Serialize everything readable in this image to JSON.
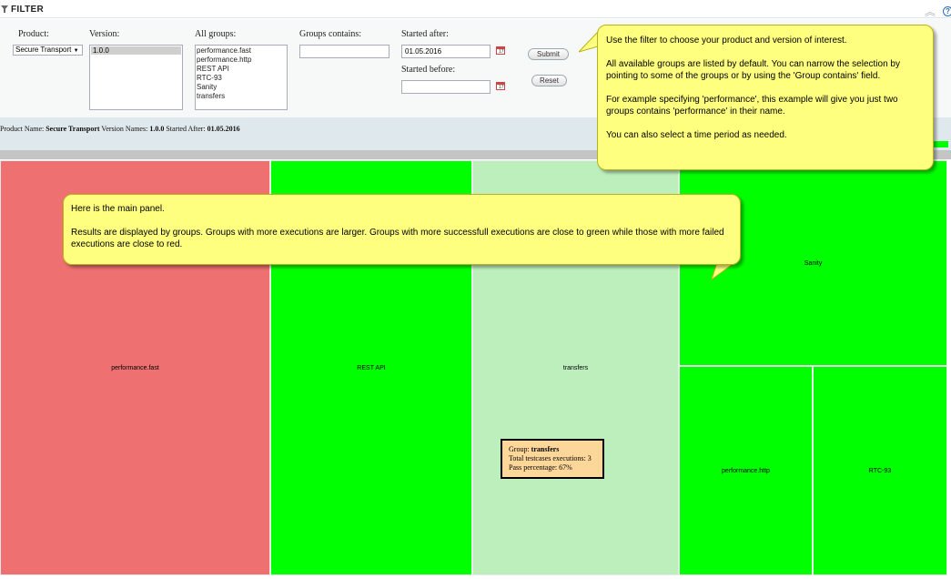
{
  "filter": {
    "title": "FILTER",
    "labels": {
      "product": "Product:",
      "version": "Version:",
      "all_groups": "All groups:",
      "groups_contains": "Groups contains:",
      "started_after": "Started after:",
      "started_before": "Started before:"
    },
    "product_value": "Secure Transport",
    "version_selected": "1.0.0",
    "groups": [
      "performance.fast",
      "performance.http",
      "REST API",
      "RTC-93",
      "Sanity",
      "transfers"
    ],
    "groups_contains_value": "",
    "started_after_value": "01.05.2016",
    "started_before_value": "",
    "submit_label": "Submit",
    "reset_label": "Reset"
  },
  "summary": {
    "product_label": "Product Name:",
    "product": "Secure Transport",
    "version_label": "Version Names:",
    "version": "1.0.0",
    "started_label": "Started After:",
    "started": "01.05.2016"
  },
  "treemap": {
    "cells": [
      {
        "name": "performance.fast",
        "color": "#ee7070"
      },
      {
        "name": "REST API",
        "color": "#00ff00"
      },
      {
        "name": "transfers",
        "color": "#bdefbd"
      },
      {
        "name": "Sanity",
        "color": "#00ff00"
      },
      {
        "name": "performance.http",
        "color": "#00ff00"
      },
      {
        "name": "RTC-93",
        "color": "#00ff00"
      }
    ]
  },
  "tooltip": {
    "group_label": "Group:",
    "group": "transfers",
    "executions_label": "Total testcases executions:",
    "executions": "3",
    "pass_label": "Pass percentage:",
    "pass": "67%"
  },
  "callouts": {
    "filter": [
      "Use the filter to choose your product and version of interest.",
      "All available groups are listed by default. You can narrow the selection by pointing to some of the groups or by using the 'Group contains' field.",
      "For example specifying 'performance', this example will give you just two groups contains 'performance' in their name.",
      "You can also select a time period as needed."
    ],
    "main": [
      "Here is the main panel.",
      "Results are displayed by groups. Groups with more executions are larger. Groups with more successfull executions are close to green while those with more failed executions are close to red."
    ]
  },
  "icons": {
    "filter": "funnel-icon",
    "collapse": "chevron-up-icon",
    "help": "help-icon",
    "calendar": "calendar-icon"
  }
}
